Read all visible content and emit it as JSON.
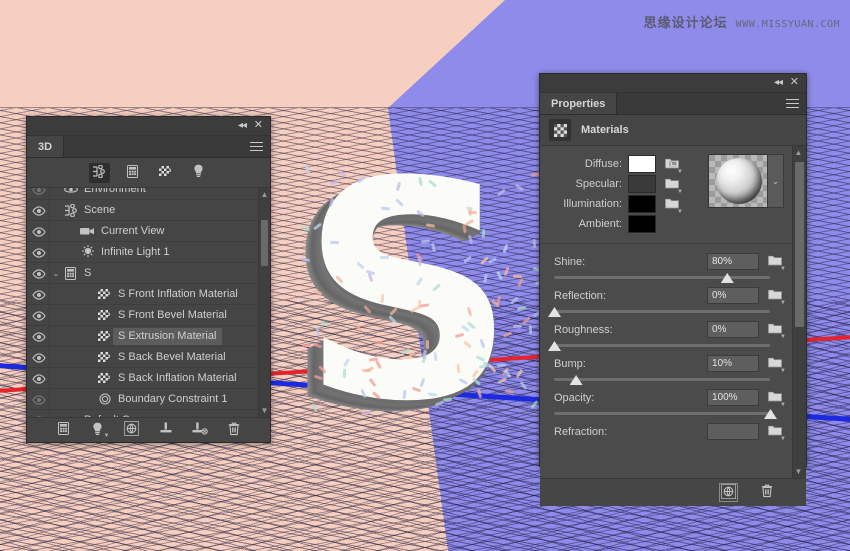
{
  "watermark": {
    "chinese": "思缘设计论坛",
    "url": "WWW.MISSYUAN.COM"
  },
  "scene": {
    "letter": "S",
    "colors": {
      "wall_left": "#f7cfc0",
      "wall_right": "#8f8bea",
      "ground": "#8f8bea",
      "axis_red": "#e4232c",
      "axis_blue": "#1b2ae0",
      "letter_face": "#fbfbf8",
      "letter_extrusion": "#6d6d6d"
    }
  },
  "panel_3d": {
    "title_collapse": "◂◂",
    "title_close": "✕",
    "tab_label": "3D",
    "menu_label": "menu",
    "filters": [
      {
        "name": "scene-filter",
        "label": "Scene",
        "active": true
      },
      {
        "name": "mesh-filter",
        "label": "Meshes",
        "active": false
      },
      {
        "name": "materials-filter",
        "label": "Materials",
        "active": false
      },
      {
        "name": "lights-filter",
        "label": "Lights",
        "active": false
      }
    ],
    "rows": [
      {
        "label": "Environment",
        "icon": "environment-icon",
        "indent": 1,
        "twisty": "",
        "selected": false,
        "partial": true
      },
      {
        "label": "Scene",
        "icon": "scene-icon",
        "indent": 1,
        "twisty": "",
        "selected": false
      },
      {
        "label": "Current View",
        "icon": "camera-icon",
        "indent": 2,
        "twisty": "",
        "selected": false
      },
      {
        "label": "Infinite Light 1",
        "icon": "light-icon",
        "indent": 2,
        "twisty": "",
        "selected": false
      },
      {
        "label": "S",
        "icon": "mesh-icon",
        "indent": 1,
        "twisty": "⌄",
        "selected": false
      },
      {
        "label": "S Front Inflation Material",
        "icon": "material-icon",
        "indent": 3,
        "twisty": "",
        "selected": false
      },
      {
        "label": "S Front Bevel Material",
        "icon": "material-icon",
        "indent": 3,
        "twisty": "",
        "selected": false
      },
      {
        "label": "S Extrusion Material",
        "icon": "material-icon",
        "indent": 3,
        "twisty": "",
        "selected": true
      },
      {
        "label": "S Back Bevel Material",
        "icon": "material-icon",
        "indent": 3,
        "twisty": "",
        "selected": false
      },
      {
        "label": "S Back Inflation Material",
        "icon": "material-icon",
        "indent": 3,
        "twisty": "",
        "selected": false
      },
      {
        "label": "Boundary Constraint 1",
        "icon": "constraint-icon",
        "indent": 3,
        "twisty": "",
        "selected": false
      },
      {
        "label": "Default Camera",
        "icon": "camera-icon",
        "indent": 1,
        "twisty": "",
        "selected": false
      }
    ],
    "footer_buttons": [
      {
        "name": "add-mesh-button",
        "label": "Add Mesh"
      },
      {
        "name": "add-light-button",
        "label": "Add Light",
        "caret": true
      },
      {
        "name": "render-button",
        "label": "Render"
      },
      {
        "name": "add-constraint-button",
        "label": "Add Constraint"
      },
      {
        "name": "remove-constraint-button",
        "label": "Remove Constraint"
      },
      {
        "name": "delete-button",
        "label": "Delete"
      }
    ]
  },
  "properties": {
    "title_collapse": "◂◂",
    "title_close": "✕",
    "tab_label": "Properties",
    "section_title": "Materials",
    "colors": [
      {
        "label": "Diffuse:",
        "value": "#ffffff",
        "folder": true,
        "folder_type": "image"
      },
      {
        "label": "Specular:",
        "value": "#3a3a3a",
        "folder": true,
        "folder_type": "plain"
      },
      {
        "label": "Illumination:",
        "value": "#000000",
        "folder": true,
        "folder_type": "plain"
      },
      {
        "label": "Ambient:",
        "value": "#000000",
        "folder": false,
        "folder_type": "none"
      }
    ],
    "sliders": [
      {
        "label": "Shine:",
        "value": "80%",
        "percent": 80
      },
      {
        "label": "Reflection:",
        "value": "0%",
        "percent": 0
      },
      {
        "label": "Roughness:",
        "value": "0%",
        "percent": 0
      },
      {
        "label": "Bump:",
        "value": "10%",
        "percent": 10
      },
      {
        "label": "Opacity:",
        "value": "100%",
        "percent": 100
      },
      {
        "label": "Refraction:",
        "value": "",
        "percent": 0
      }
    ],
    "footer_buttons": [
      {
        "name": "new-material-button",
        "label": "New Material"
      },
      {
        "name": "delete-material-button",
        "label": "Delete Material"
      }
    ]
  }
}
